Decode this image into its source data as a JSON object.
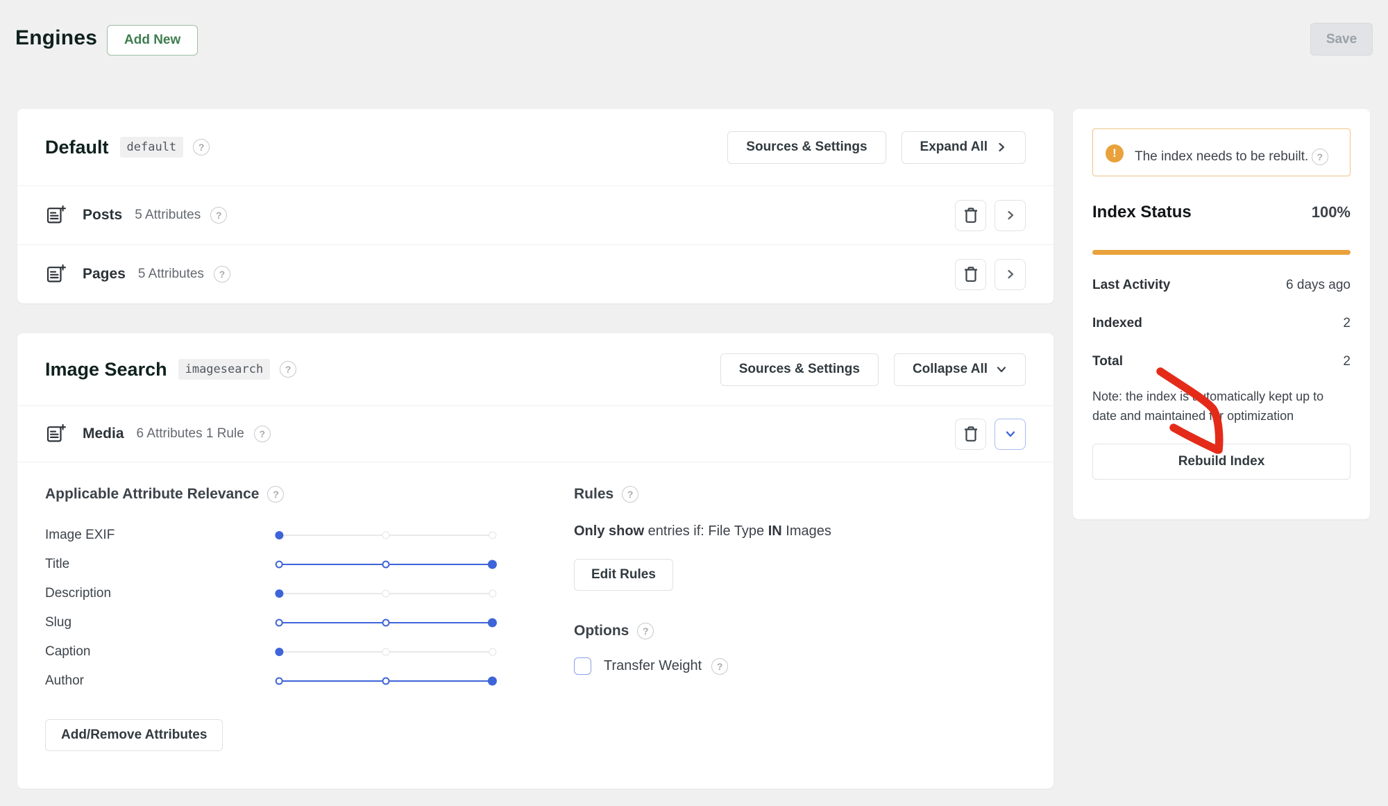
{
  "colors": {
    "accent_blue": "#3e64d9",
    "warning_amber": "#e9a13b",
    "arrow_red": "#e42b1a",
    "brand_green": "#3e7d4f"
  },
  "header": {
    "title": "Engines",
    "add_new_label": "Add New",
    "save_label": "Save"
  },
  "default_engine": {
    "title": "Default",
    "slug_badge": "default",
    "sources_settings_label": "Sources & Settings",
    "expand_all_label": "Expand All",
    "rows": [
      {
        "name": "Posts",
        "meta": "5 Attributes"
      },
      {
        "name": "Pages",
        "meta": "5 Attributes"
      }
    ]
  },
  "image_engine": {
    "title": "Image Search",
    "slug_badge": "imagesearch",
    "sources_settings_label": "Sources & Settings",
    "collapse_all_label": "Collapse All",
    "row": {
      "name": "Media",
      "meta": "6 Attributes 1 Rule"
    }
  },
  "attributes_panel": {
    "heading": "Applicable Attribute Relevance",
    "sliders": [
      {
        "label": "Image EXIF",
        "value": "min"
      },
      {
        "label": "Title",
        "value": "max"
      },
      {
        "label": "Description",
        "value": "min"
      },
      {
        "label": "Slug",
        "value": "max"
      },
      {
        "label": "Caption",
        "value": "min"
      },
      {
        "label": "Author",
        "value": "max"
      }
    ],
    "add_remove_label": "Add/Remove Attributes"
  },
  "rules_panel": {
    "heading": "Rules",
    "rule_bold_prefix": "Only show",
    "rule_mid": " entries if: File Type ",
    "rule_bold_in": "IN",
    "rule_suffix": " Images",
    "edit_rules_label": "Edit Rules"
  },
  "options_panel": {
    "heading": "Options",
    "transfer_weight_label": "Transfer Weight",
    "checkbox_checked": false
  },
  "sidebar": {
    "warning_text": "The index needs to be rebuilt.",
    "index_status_label": "Index Status",
    "index_status_value": "100%",
    "stats": [
      {
        "label": "Last Activity",
        "value": "6 days ago"
      },
      {
        "label": "Indexed",
        "value": "2"
      },
      {
        "label": "Total",
        "value": "2"
      }
    ],
    "note": "Note: the index is automatically kept up to date and maintained for optimization",
    "rebuild_label": "Rebuild Index"
  }
}
